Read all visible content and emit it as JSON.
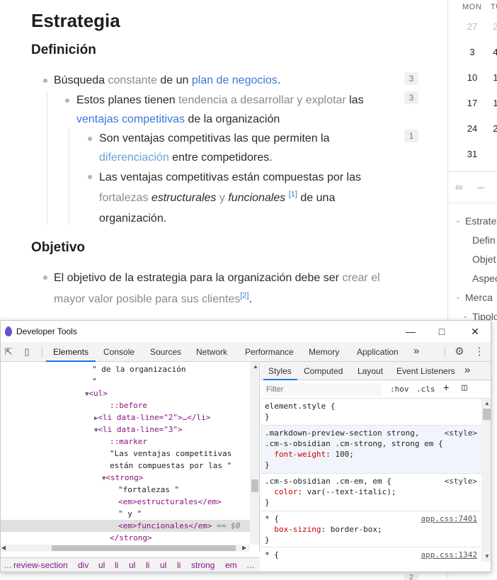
{
  "note": {
    "title": "Estrategia",
    "h_definicion": "Definición",
    "h_objetivo": "Objetivo",
    "l1": {
      "a": "Búsqueda ",
      "b": "constante",
      "c": " de un ",
      "d": "plan de negocios",
      "e": ".",
      "count": "3"
    },
    "l2": {
      "a": "Estos planes tienen ",
      "b": "tendencia a desarrollar y explotar",
      "c": " las",
      "d": "ventajas competitivas",
      "e": " de la organización",
      "count": "3"
    },
    "l3": {
      "a": "Son ventajas competitivas las que permiten la",
      "b": "diferenciación",
      "c": " entre competidores.",
      "count": "1"
    },
    "l4": {
      "a": "Las ventajas competitivas están compuestas por las",
      "b": "fortalezas",
      "c": "estructurales",
      "d": " y ",
      "e": "funcionales",
      "f": "[1]",
      "g": " de una",
      "h": "organización."
    },
    "l5": {
      "a": "El objetivo de la estrategia para la organización debe ser ",
      "b": "crear el",
      "c": "mayor valor posible para sus clientes",
      "d": "[2]",
      "e": "."
    },
    "bottom_count": "2"
  },
  "calendar": {
    "headers": [
      "MON",
      "TU"
    ],
    "rows": [
      [
        "27",
        "2"
      ],
      [
        "3",
        "4"
      ],
      [
        "10",
        "1"
      ],
      [
        "17",
        "1"
      ],
      [
        "24",
        "2"
      ],
      [
        "31",
        ""
      ]
    ]
  },
  "outline": {
    "items": [
      "Estrate",
      "Defin",
      "Objet",
      "Aspec",
      "Merca",
      "Tipolo"
    ]
  },
  "devtools": {
    "title": "Developer Tools",
    "tabs": [
      "Elements",
      "Console",
      "Sources",
      "Network",
      "Performance",
      "Memory",
      "Application"
    ],
    "more": "»",
    "dom_lines": [
      {
        "t": "\" de la organización"
      },
      {
        "t": "\""
      },
      {
        "t": "<ul>"
      },
      {
        "t": "::before"
      },
      {
        "t": "<li data-line=\"2\">…</li>"
      },
      {
        "t": "<li data-line=\"3\">"
      },
      {
        "t": "::marker"
      },
      {
        "t": "\"Las ventajas competitivas"
      },
      {
        "t": "están compuestas por las \""
      },
      {
        "t": "<strong>"
      },
      {
        "t": "\"fortalezas \""
      },
      {
        "t": "<em>estructurales</em>"
      },
      {
        "t": "\" y \""
      },
      {
        "t": "<em>funcionales</em>"
      },
      {
        "t": "== $0"
      },
      {
        "t": "</strong>"
      }
    ],
    "crumbs": [
      "…",
      "review-section",
      "div",
      "ul",
      "li",
      "ul",
      "li",
      "ul",
      "li",
      "strong",
      "em",
      "…"
    ],
    "style_tabs": [
      "Styles",
      "Computed",
      "Layout",
      "Event Listeners"
    ],
    "filter_placeholder": "Filter",
    "hov": ":hov",
    "cls": ".cls",
    "rules": {
      "r1_sel": "element.style {",
      "r1_end": "}",
      "r2_sel1": ".markdown-preview-section strong,",
      "r2_sel2": ".cm-s-obsidian .cm-strong, strong em {",
      "r2_prop": "font-weight",
      "r2_val": ": 100;",
      "r2_src": "<style>",
      "r2_end": "}",
      "r3_sel": ".cm-s-obsidian .cm-em, em {",
      "r3_prop": "color",
      "r3_val": ": var(--text-italic);",
      "r3_src": "<style>",
      "r3_end": "}",
      "r4_sel": "* {",
      "r4_prop": "box-sizing",
      "r4_val": ": border-box;",
      "r4_src": "app.css:7401",
      "r4_end": "}",
      "r5_sel": "* {",
      "r5_src": "app.css:1342"
    }
  }
}
